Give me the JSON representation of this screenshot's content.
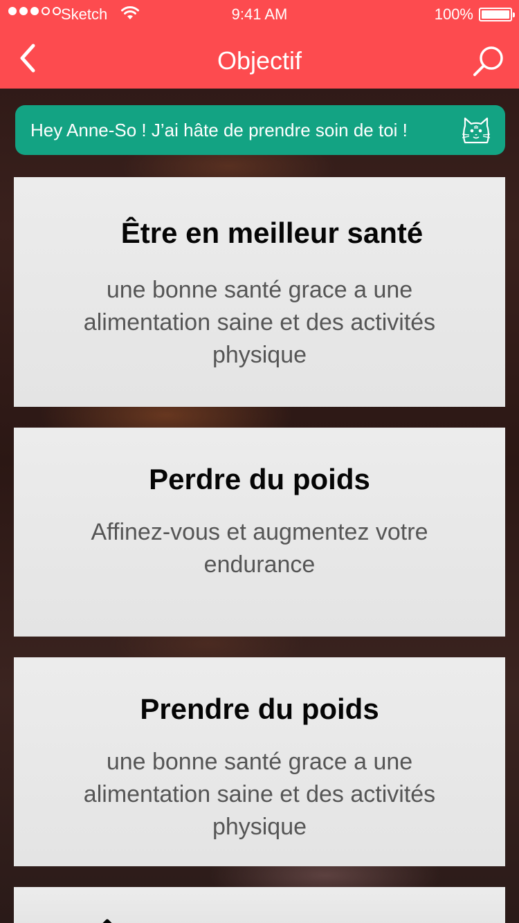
{
  "status_bar": {
    "carrier": "Sketch",
    "time": "9:41 AM",
    "battery": "100%",
    "signal_bars_filled": 3,
    "signal_bars_total": 5
  },
  "nav": {
    "title": "Objectif",
    "back_icon": "chevron-left-icon",
    "search_icon": "search-icon"
  },
  "greeting": {
    "text": "Hey Anne-So ! J’ai hâte de prendre soin de toi !",
    "icon": "cat-icon"
  },
  "goals": [
    {
      "title": "Être en meilleur santé",
      "description": "une bonne santé grace a une alimentation saine et des activités physique"
    },
    {
      "title": "Perdre du poids",
      "description": "Affinez-vous et augmentez votre endurance"
    },
    {
      "title": "Prendre du poids",
      "description": "une bonne santé grace a une alimentation saine et des activités physique"
    }
  ],
  "colors": {
    "header": "#fd4b4f",
    "greeting_bg": "#13a383",
    "card_bg": "#e8e8e8"
  }
}
